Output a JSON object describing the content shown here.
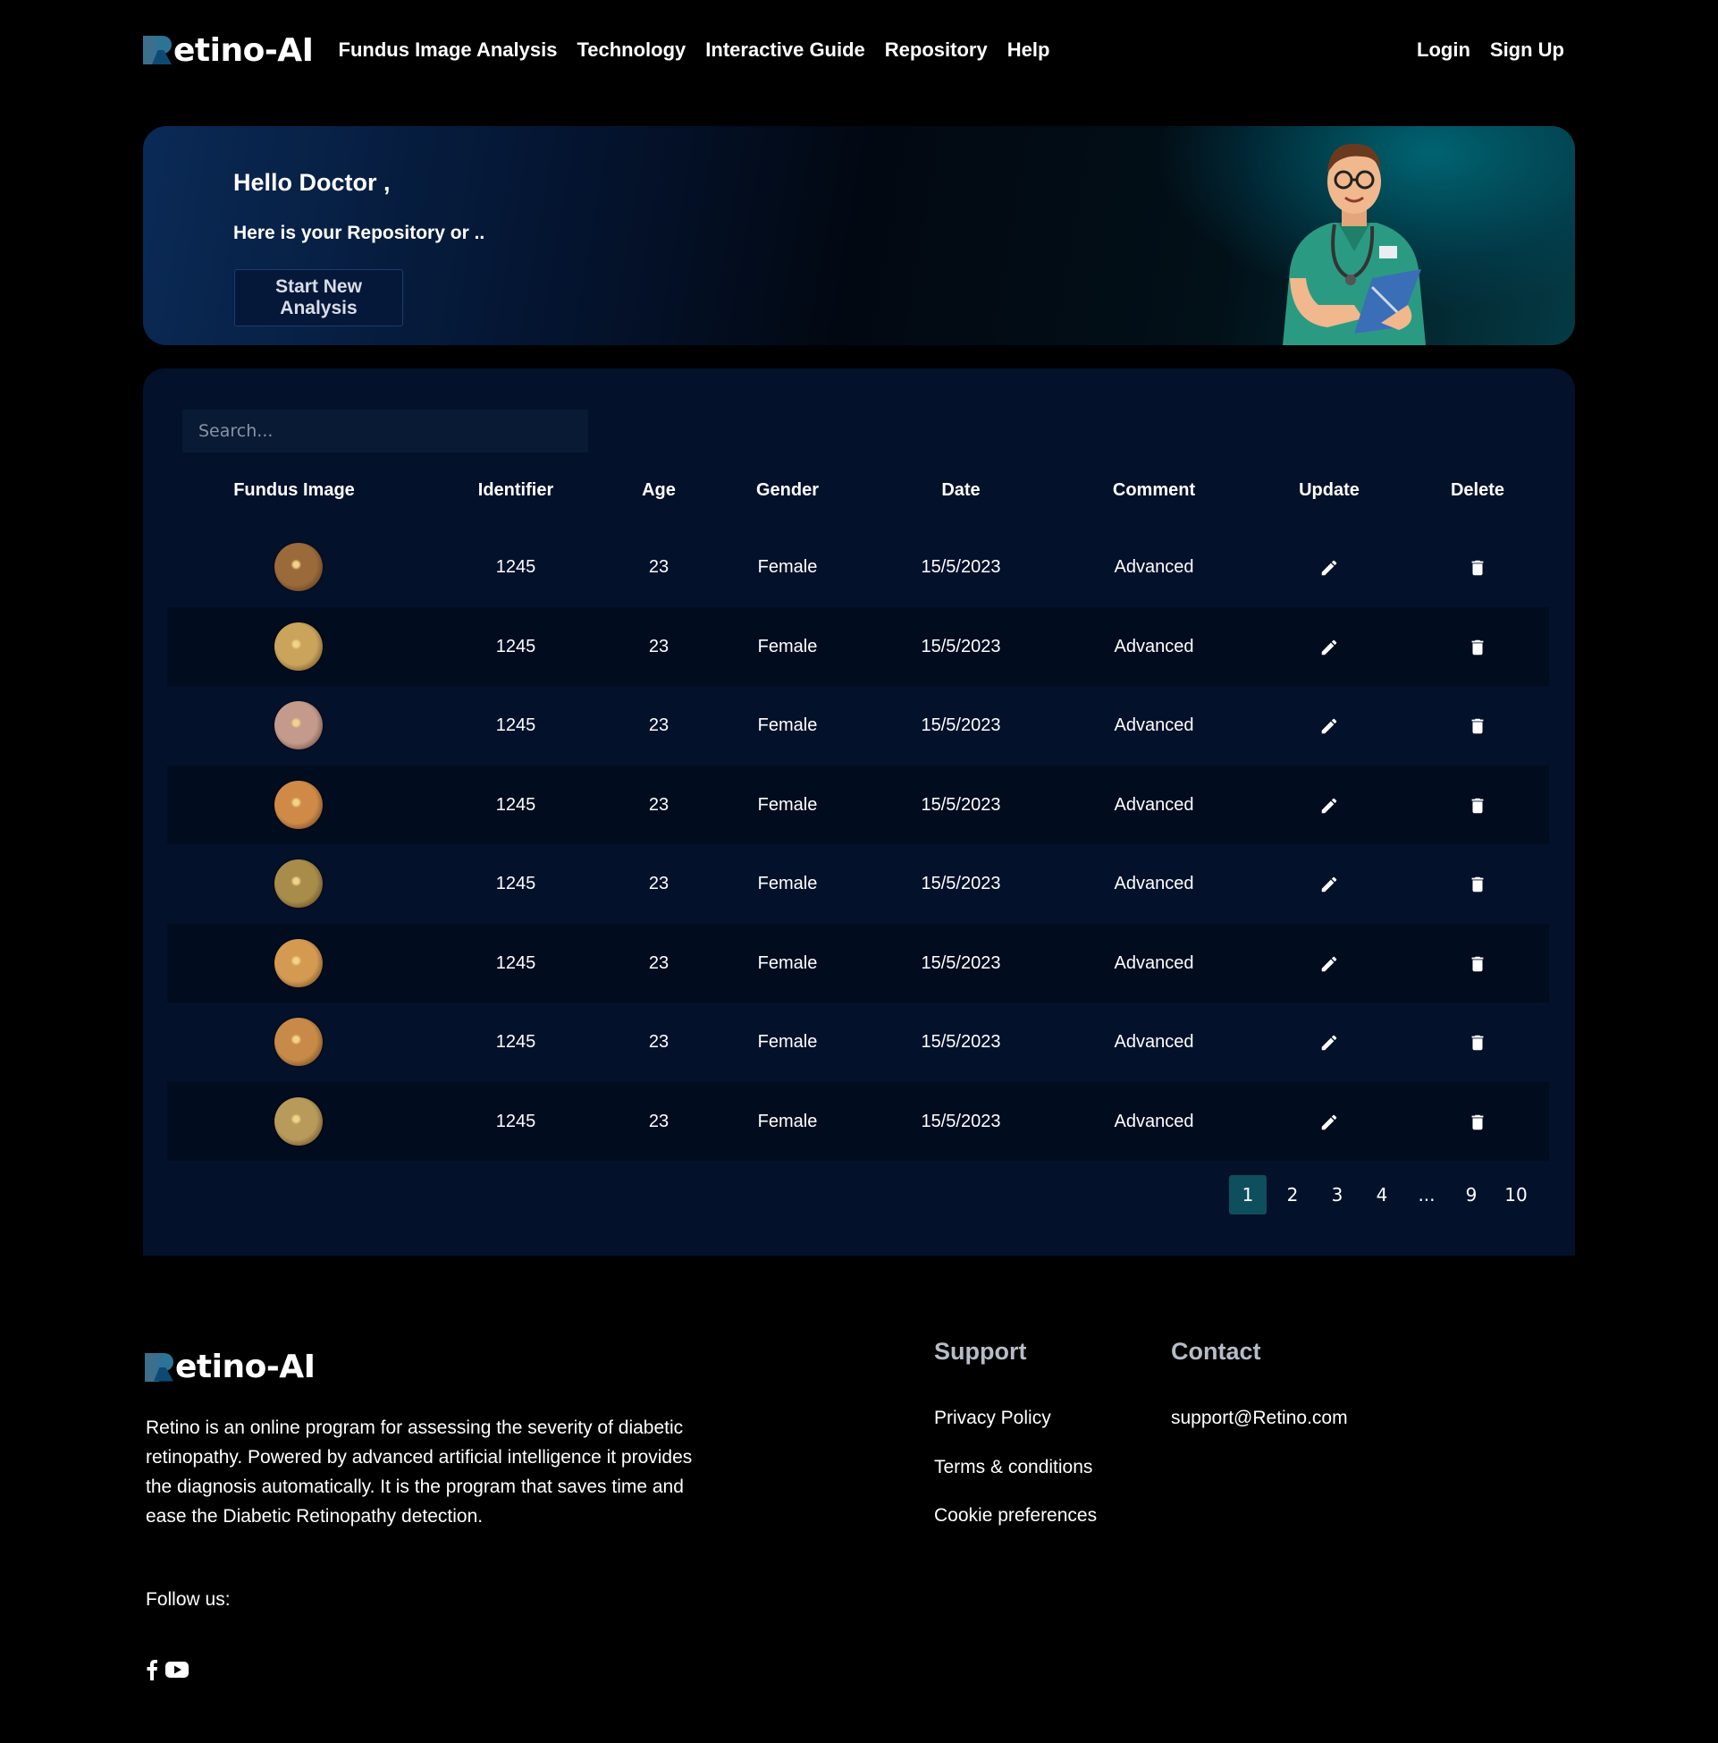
{
  "brand": {
    "name": "etino-AI"
  },
  "nav": {
    "links": [
      "Fundus Image Analysis",
      "Technology",
      "Interactive Guide",
      "Repository",
      "Help"
    ],
    "login": "Login",
    "signup": "Sign Up"
  },
  "hero": {
    "title": "Hello Doctor ,",
    "subtitle": "Here is your Repository or ..",
    "button": "Start New Analysis"
  },
  "search": {
    "placeholder": "Search..."
  },
  "table": {
    "headers": [
      "Fundus Image",
      "Identifier",
      "Age",
      "Gender",
      "Date",
      "Comment",
      "Update",
      "Delete"
    ],
    "rows": [
      {
        "identifier": "1245",
        "age": "23",
        "gender": "Female",
        "date": "15/5/2023",
        "comment": "Advanced",
        "fundus_color": "#9a6a3a"
      },
      {
        "identifier": "1245",
        "age": "23",
        "gender": "Female",
        "date": "15/5/2023",
        "comment": "Advanced",
        "fundus_color": "#c9a45a"
      },
      {
        "identifier": "1245",
        "age": "23",
        "gender": "Female",
        "date": "15/5/2023",
        "comment": "Advanced",
        "fundus_color": "#c49a8c"
      },
      {
        "identifier": "1245",
        "age": "23",
        "gender": "Female",
        "date": "15/5/2023",
        "comment": "Advanced",
        "fundus_color": "#d08a48"
      },
      {
        "identifier": "1245",
        "age": "23",
        "gender": "Female",
        "date": "15/5/2023",
        "comment": "Advanced",
        "fundus_color": "#a88c4a"
      },
      {
        "identifier": "1245",
        "age": "23",
        "gender": "Female",
        "date": "15/5/2023",
        "comment": "Advanced",
        "fundus_color": "#d49a52"
      },
      {
        "identifier": "1245",
        "age": "23",
        "gender": "Female",
        "date": "15/5/2023",
        "comment": "Advanced",
        "fundus_color": "#c88a48"
      },
      {
        "identifier": "1245",
        "age": "23",
        "gender": "Female",
        "date": "15/5/2023",
        "comment": "Advanced",
        "fundus_color": "#b89a5a"
      }
    ],
    "update_icon": "pencil-icon",
    "delete_icon": "trash-icon"
  },
  "pagination": {
    "pages": [
      "1",
      "2",
      "3",
      "4",
      "...",
      "9",
      "10"
    ],
    "active": "1"
  },
  "footer": {
    "description": "Retino is an online program for assessing the severity of diabetic retinopathy. Powered by advanced artificial intelligence it provides the diagnosis automatically. It is the program that saves time and ease the Diabetic Retinopathy detection.",
    "follow": "Follow us:",
    "support_title": "Support",
    "support_links": [
      "Privacy Policy",
      "Terms & conditions",
      "Cookie preferences"
    ],
    "contact_title": "Contact",
    "contact_email": "support@Retino.com",
    "social_icons": [
      "facebook-icon",
      "youtube-icon"
    ]
  },
  "colors": {
    "background": "#000000",
    "panel": "#04112b",
    "active_page": "#0e4f5e",
    "button_bg": "#05183a"
  }
}
